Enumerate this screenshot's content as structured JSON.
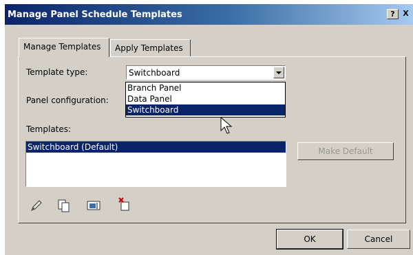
{
  "window": {
    "title": "Manage Panel Schedule Templates",
    "help_label": "?",
    "close_label": "X"
  },
  "tabs": [
    {
      "label": "Manage Templates",
      "active": true
    },
    {
      "label": "Apply Templates",
      "active": false
    }
  ],
  "form": {
    "template_type_label": "Template type:",
    "template_type_value": "Switchboard",
    "panel_config_label": "Panel configuration:",
    "templates_label": "Templates:"
  },
  "dropdown": {
    "options": [
      "Branch Panel",
      "Data Panel",
      "Switchboard"
    ],
    "selected": "Switchboard"
  },
  "templates_list": {
    "items": [
      "Switchboard (Default)"
    ],
    "selected": "Switchboard (Default)"
  },
  "buttons": {
    "make_default": "Make Default",
    "ok": "OK",
    "cancel": "Cancel"
  },
  "toolbar_icons": [
    "edit-icon",
    "duplicate-icon",
    "rename-icon",
    "delete-icon"
  ],
  "colors": {
    "title_bar_start": "#0a246a",
    "title_bar_end": "#a6caf0",
    "selection": "#0a246a",
    "dialog_face": "#d4d0c8"
  }
}
